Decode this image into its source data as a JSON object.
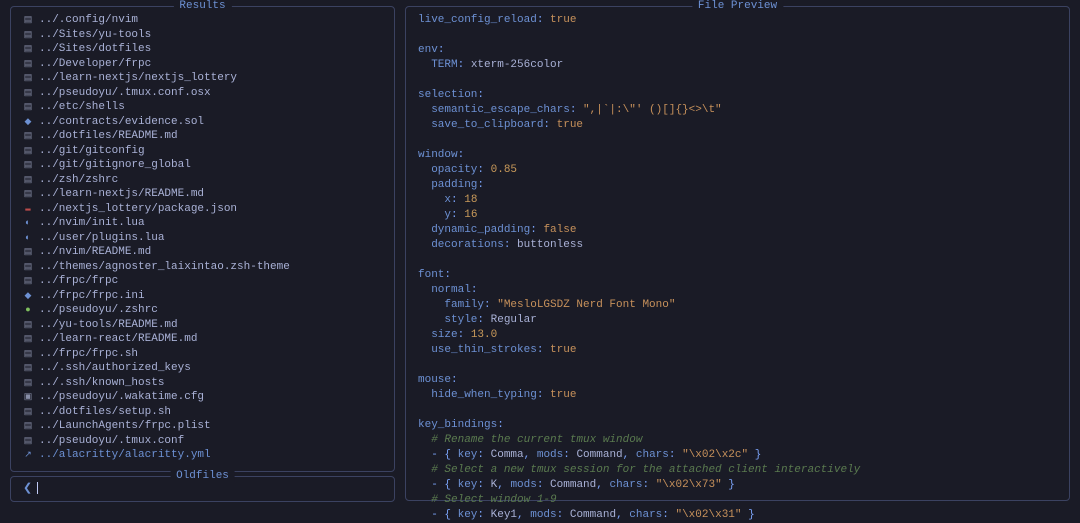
{
  "panels": {
    "results_title": "Results",
    "oldfiles_title": "Oldfiles",
    "preview_title": "File Preview"
  },
  "oldfiles": {
    "prompt_icon": "❮",
    "input_value": ""
  },
  "results": [
    {
      "icon": "▤",
      "cls": "i-file",
      "path": "../.config/nvim"
    },
    {
      "icon": "▤",
      "cls": "i-file",
      "path": "../Sites/yu-tools"
    },
    {
      "icon": "▤",
      "cls": "i-file",
      "path": "../Sites/dotfiles"
    },
    {
      "icon": "▤",
      "cls": "i-file",
      "path": "../Developer/frpc"
    },
    {
      "icon": "▤",
      "cls": "i-file",
      "path": "../learn-nextjs/nextjs_lottery"
    },
    {
      "icon": "▤",
      "cls": "i-file",
      "path": "../pseudoyu/.tmux.conf.osx"
    },
    {
      "icon": "▤",
      "cls": "i-file",
      "path": "../etc/shells"
    },
    {
      "icon": "◆",
      "cls": "i-sol",
      "path": "../contracts/evidence.sol"
    },
    {
      "icon": "▤",
      "cls": "i-file",
      "path": "../dotfiles/README.md"
    },
    {
      "icon": "▤",
      "cls": "i-file",
      "path": "../git/gitconfig"
    },
    {
      "icon": "▤",
      "cls": "i-file",
      "path": "../git/gitignore_global"
    },
    {
      "icon": "▤",
      "cls": "i-file",
      "path": "../zsh/zshrc"
    },
    {
      "icon": "▤",
      "cls": "i-file",
      "path": "../learn-nextjs/README.md"
    },
    {
      "icon": "▬",
      "cls": "i-json",
      "path": "../nextjs_lottery/package.json"
    },
    {
      "icon": "◐",
      "cls": "i-lua",
      "path": "../nvim/init.lua"
    },
    {
      "icon": "◐",
      "cls": "i-lua",
      "path": "../user/plugins.lua"
    },
    {
      "icon": "▤",
      "cls": "i-file",
      "path": "../nvim/README.md"
    },
    {
      "icon": "▤",
      "cls": "i-file",
      "path": "../themes/agnoster_laixintao.zsh-theme"
    },
    {
      "icon": "▤",
      "cls": "i-file",
      "path": "../frpc/frpc"
    },
    {
      "icon": "◆",
      "cls": "i-ini",
      "path": "../frpc/frpc.ini"
    },
    {
      "icon": "●",
      "cls": "i-green",
      "path": "../pseudoyu/.zshrc"
    },
    {
      "icon": "▤",
      "cls": "i-file",
      "path": "../yu-tools/README.md"
    },
    {
      "icon": "▤",
      "cls": "i-file",
      "path": "../learn-react/README.md"
    },
    {
      "icon": "▤",
      "cls": "i-file",
      "path": "../frpc/frpc.sh"
    },
    {
      "icon": "▤",
      "cls": "i-file",
      "path": "../.ssh/authorized_keys"
    },
    {
      "icon": "▤",
      "cls": "i-file",
      "path": "../.ssh/known_hosts"
    },
    {
      "icon": "▣",
      "cls": "i-file",
      "path": "../pseudoyu/.wakatime.cfg"
    },
    {
      "icon": "▤",
      "cls": "i-file",
      "path": "../dotfiles/setup.sh"
    },
    {
      "icon": "▤",
      "cls": "i-file",
      "path": "../LaunchAgents/frpc.plist"
    },
    {
      "icon": "▤",
      "cls": "i-file",
      "path": "../pseudoyu/.tmux.conf"
    },
    {
      "icon": "↗",
      "cls": "i-arrow",
      "path": "../alacritty/alacritty.yml",
      "selected": true
    }
  ],
  "preview": [
    [
      [
        "ck",
        "live_config_reload"
      ],
      [
        "cp",
        ": "
      ],
      [
        "cb",
        "true"
      ]
    ],
    [
      [
        "",
        ""
      ]
    ],
    [
      [
        "ck",
        "env"
      ],
      [
        "cp",
        ":"
      ]
    ],
    [
      [
        "cpl",
        "  "
      ],
      [
        "ck",
        "TERM"
      ],
      [
        "cp",
        ": "
      ],
      [
        "cpl",
        "xterm-256color"
      ]
    ],
    [
      [
        "",
        ""
      ]
    ],
    [
      [
        "ck",
        "selection"
      ],
      [
        "cp",
        ":"
      ]
    ],
    [
      [
        "cpl",
        "  "
      ],
      [
        "ck",
        "semantic_escape_chars"
      ],
      [
        "cp",
        ": "
      ],
      [
        "cs",
        "\",|`|:\\\"' ()[]{}<>\\t\""
      ]
    ],
    [
      [
        "cpl",
        "  "
      ],
      [
        "ck",
        "save_to_clipboard"
      ],
      [
        "cp",
        ": "
      ],
      [
        "cb",
        "true"
      ]
    ],
    [
      [
        "",
        ""
      ]
    ],
    [
      [
        "ck",
        "window"
      ],
      [
        "cp",
        ":"
      ]
    ],
    [
      [
        "cpl",
        "  "
      ],
      [
        "ck",
        "opacity"
      ],
      [
        "cp",
        ": "
      ],
      [
        "cn",
        "0.85"
      ]
    ],
    [
      [
        "cpl",
        "  "
      ],
      [
        "ck",
        "padding"
      ],
      [
        "cp",
        ":"
      ]
    ],
    [
      [
        "cpl",
        "    "
      ],
      [
        "ck",
        "x"
      ],
      [
        "cp",
        ": "
      ],
      [
        "cn",
        "18"
      ]
    ],
    [
      [
        "cpl",
        "    "
      ],
      [
        "ck",
        "y"
      ],
      [
        "cp",
        ": "
      ],
      [
        "cn",
        "16"
      ]
    ],
    [
      [
        "cpl",
        "  "
      ],
      [
        "ck",
        "dynamic_padding"
      ],
      [
        "cp",
        ": "
      ],
      [
        "cb",
        "false"
      ]
    ],
    [
      [
        "cpl",
        "  "
      ],
      [
        "ck",
        "decorations"
      ],
      [
        "cp",
        ": "
      ],
      [
        "cpl",
        "buttonless"
      ]
    ],
    [
      [
        "",
        ""
      ]
    ],
    [
      [
        "ck",
        "font"
      ],
      [
        "cp",
        ":"
      ]
    ],
    [
      [
        "cpl",
        "  "
      ],
      [
        "ck",
        "normal"
      ],
      [
        "cp",
        ":"
      ]
    ],
    [
      [
        "cpl",
        "    "
      ],
      [
        "ck",
        "family"
      ],
      [
        "cp",
        ": "
      ],
      [
        "cs",
        "\"MesloLGSDZ Nerd Font Mono\""
      ]
    ],
    [
      [
        "cpl",
        "    "
      ],
      [
        "ck",
        "style"
      ],
      [
        "cp",
        ": "
      ],
      [
        "cpl",
        "Regular"
      ]
    ],
    [
      [
        "cpl",
        "  "
      ],
      [
        "ck",
        "size"
      ],
      [
        "cp",
        ": "
      ],
      [
        "cn",
        "13.0"
      ]
    ],
    [
      [
        "cpl",
        "  "
      ],
      [
        "ck",
        "use_thin_strokes"
      ],
      [
        "cp",
        ": "
      ],
      [
        "cb",
        "true"
      ]
    ],
    [
      [
        "",
        ""
      ]
    ],
    [
      [
        "ck",
        "mouse"
      ],
      [
        "cp",
        ":"
      ]
    ],
    [
      [
        "cpl",
        "  "
      ],
      [
        "ck",
        "hide_when_typing"
      ],
      [
        "cp",
        ": "
      ],
      [
        "cb",
        "true"
      ]
    ],
    [
      [
        "",
        ""
      ]
    ],
    [
      [
        "ck",
        "key_bindings"
      ],
      [
        "cp",
        ":"
      ]
    ],
    [
      [
        "cpl",
        "  "
      ],
      [
        "cc",
        "# Rename the current tmux window"
      ]
    ],
    [
      [
        "cpl",
        "  "
      ],
      [
        "cp",
        "- { "
      ],
      [
        "ck",
        "key"
      ],
      [
        "cp",
        ": "
      ],
      [
        "cpl",
        "Comma"
      ],
      [
        "cp",
        ", "
      ],
      [
        "ck",
        "mods"
      ],
      [
        "cp",
        ": "
      ],
      [
        "cpl",
        "Command"
      ],
      [
        "cp",
        ", "
      ],
      [
        "ck",
        "chars"
      ],
      [
        "cp",
        ": "
      ],
      [
        "cs",
        "\"\\x02\\x2c\""
      ],
      [
        "cp",
        " }"
      ]
    ],
    [
      [
        "cpl",
        "  "
      ],
      [
        "cc",
        "# Select a new tmux session for the attached client interactively"
      ]
    ],
    [
      [
        "cpl",
        "  "
      ],
      [
        "cp",
        "- { "
      ],
      [
        "ck",
        "key"
      ],
      [
        "cp",
        ": "
      ],
      [
        "cpl",
        "K"
      ],
      [
        "cp",
        ", "
      ],
      [
        "ck",
        "mods"
      ],
      [
        "cp",
        ": "
      ],
      [
        "cpl",
        "Command"
      ],
      [
        "cp",
        ", "
      ],
      [
        "ck",
        "chars"
      ],
      [
        "cp",
        ": "
      ],
      [
        "cs",
        "\"\\x02\\x73\""
      ],
      [
        "cp",
        " }"
      ]
    ],
    [
      [
        "cpl",
        "  "
      ],
      [
        "cc",
        "# Select window 1-9"
      ]
    ],
    [
      [
        "cpl",
        "  "
      ],
      [
        "cp",
        "- { "
      ],
      [
        "ck",
        "key"
      ],
      [
        "cp",
        ": "
      ],
      [
        "cpl",
        "Key1"
      ],
      [
        "cp",
        ", "
      ],
      [
        "ck",
        "mods"
      ],
      [
        "cp",
        ": "
      ],
      [
        "cpl",
        "Command"
      ],
      [
        "cp",
        ", "
      ],
      [
        "ck",
        "chars"
      ],
      [
        "cp",
        ": "
      ],
      [
        "cs",
        "\"\\x02\\x31\""
      ],
      [
        "cp",
        " }"
      ]
    ]
  ]
}
